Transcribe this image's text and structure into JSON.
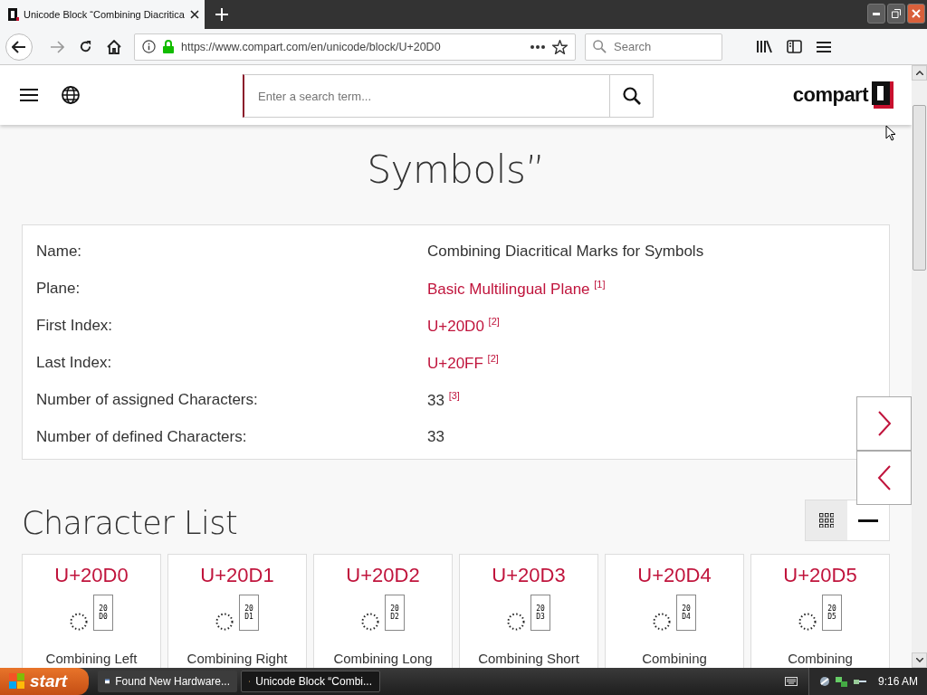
{
  "browser": {
    "tab": {
      "title": "Unicode Block “Combining Diacritica",
      "selected": true
    },
    "url": "https://www.compart.com/en/unicode/block/U+20D0",
    "search": {
      "placeholder": "Search"
    }
  },
  "site_header": {
    "search": {
      "placeholder": "Enter a search term..."
    },
    "logo": "compart"
  },
  "title_lines": [
    "Symbols”"
  ],
  "info": [
    {
      "label": "Name:",
      "value": "Combining Diacritical Marks for Symbols",
      "kind": "text"
    },
    {
      "label": "Plane:",
      "value": "Basic Multilingual Plane $^{[1]}$",
      "kind": "link"
    },
    {
      "label": "First Index:",
      "value": "U+20D0 $^{[2]}$",
      "kind": "link"
    },
    {
      "label": "Last Index:",
      "value": "U+20FF $^{[2]}$",
      "kind": "link"
    },
    {
      "label": "Number of assigned Characters:",
      "value": "33 $^{[3]}$",
      "kind": "text"
    },
    {
      "label": "Number of defined Characters:",
      "value": "33",
      "kind": "text"
    }
  ],
  "section_title": "Character List",
  "view_modes": [
    {
      "kind": "grid",
      "selected": true
    },
    {
      "kind": "list",
      "selected": false
    }
  ],
  "characters": [
    {
      "code": "U+20D0",
      "glyph_lines": [
        "20",
        "D0"
      ],
      "name": "Combining Left"
    },
    {
      "code": "U+20D1",
      "glyph_lines": [
        "20",
        "D1"
      ],
      "name": "Combining Right"
    },
    {
      "code": "U+20D2",
      "glyph_lines": [
        "20",
        "D2"
      ],
      "name": "Combining Long"
    },
    {
      "code": "U+20D3",
      "glyph_lines": [
        "20",
        "D3"
      ],
      "name": "Combining Short"
    },
    {
      "code": "U+20D4",
      "glyph_lines": [
        "20",
        "D4"
      ],
      "name": "Combining"
    },
    {
      "code": "U+20D5",
      "glyph_lines": [
        "20",
        "D5"
      ],
      "name": "Combining"
    }
  ],
  "taskbar": {
    "start": "start",
    "tasks": [
      {
        "label": "Found New Hardware...",
        "selected": false
      },
      {
        "label": "Unicode Block “Combi...",
        "selected": true
      }
    ],
    "clock": "9:16 AM"
  }
}
